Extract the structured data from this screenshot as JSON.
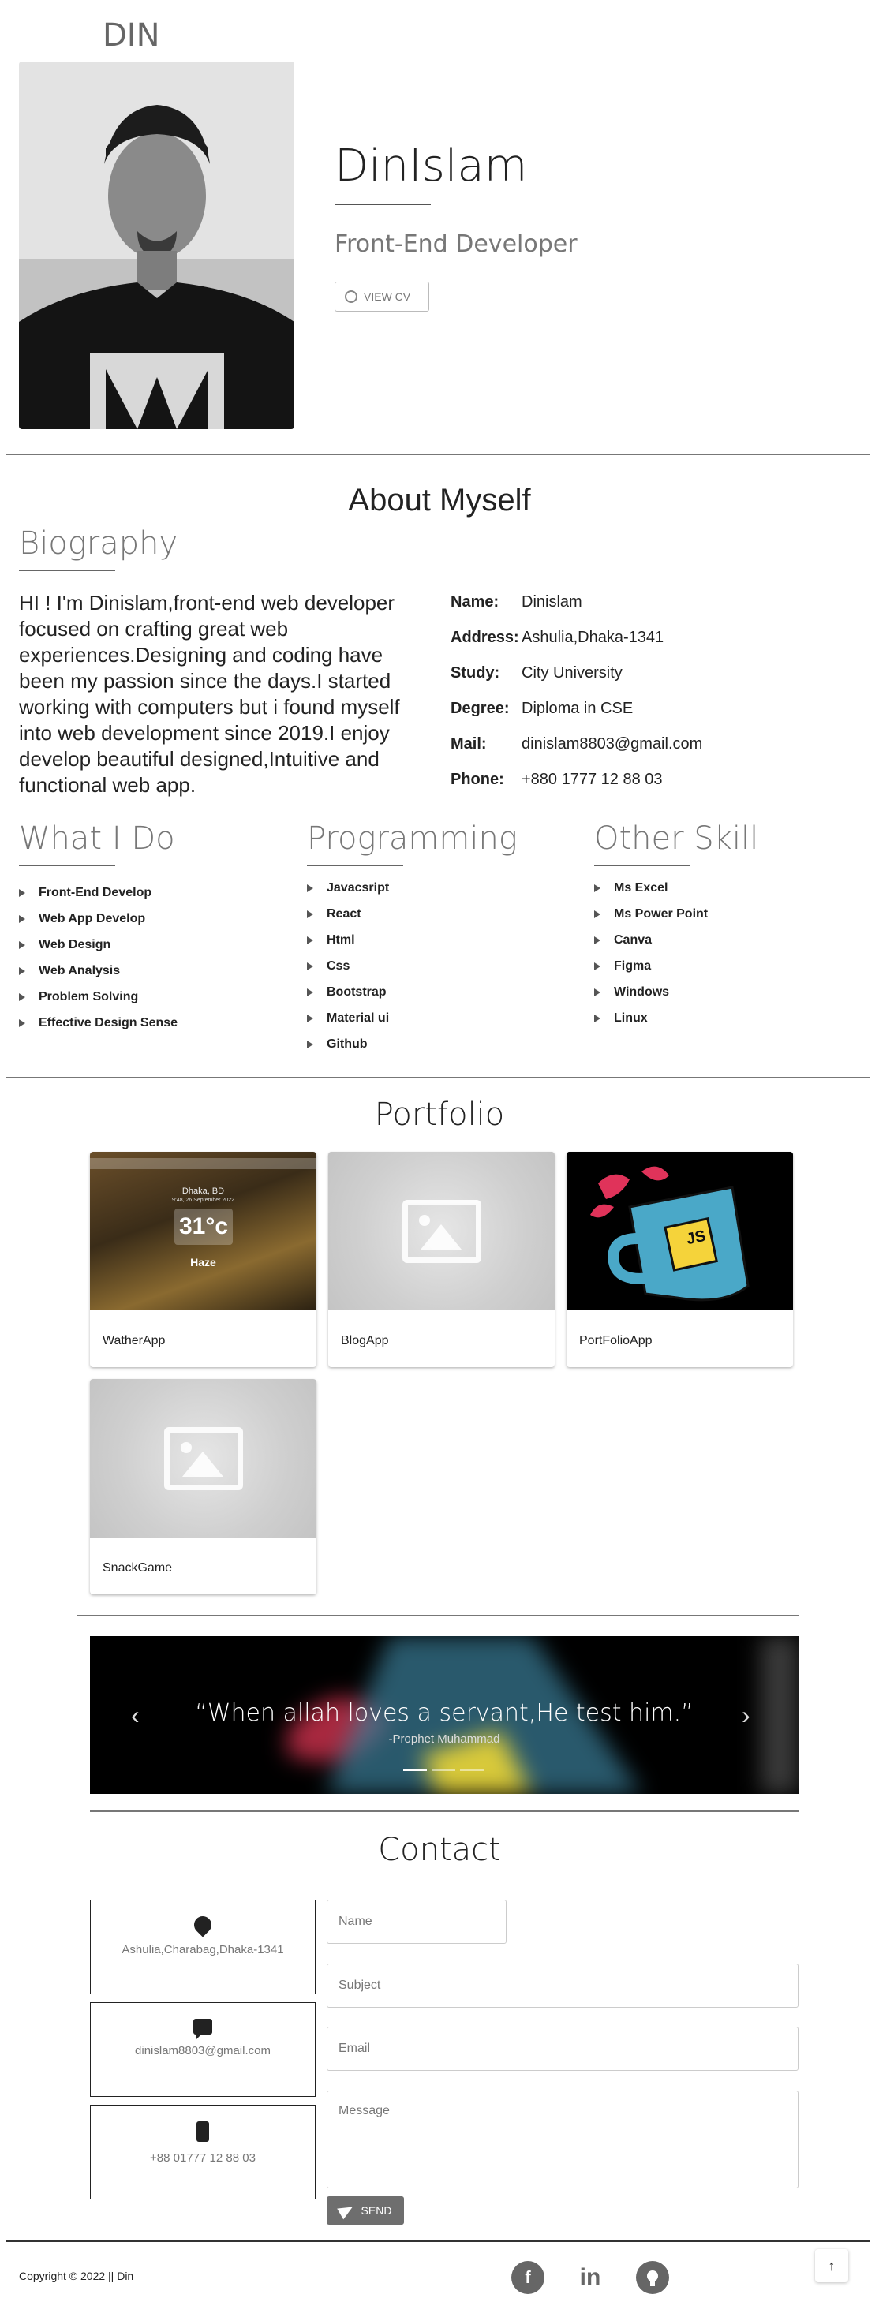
{
  "header": {
    "brand": "DIN"
  },
  "hero": {
    "name": "DinIslam",
    "role": "Front-End Developer",
    "cv_button": "VIEW CV"
  },
  "about": {
    "title": "About Myself",
    "biography_title": "Biography",
    "biography": "HI ! I'm Dinislam,front-end web developer focused on crafting great web experiences.Designing and coding have been my passion since the days.I started working with computers but i found myself into web development since 2019.I enjoy develop beautiful designed,Intuitive and functional web app.",
    "info": [
      {
        "label": "Name:",
        "value": "Dinislam"
      },
      {
        "label": "Address:",
        "value": "Ashulia,Dhaka-1341"
      },
      {
        "label": "Study:",
        "value": "City University"
      },
      {
        "label": "Degree:",
        "value": "Diploma in CSE"
      },
      {
        "label": "Mail:",
        "value": "dinislam8803@gmail.com"
      },
      {
        "label": "Phone:",
        "value": "+880 1777 12 88 03"
      }
    ]
  },
  "skills": {
    "what_i_do": {
      "title": "What I Do",
      "items": [
        "Front-End Develop",
        "Web App Develop",
        "Web Design",
        "Web Analysis",
        "Problem Solving",
        "Effective Design Sense"
      ]
    },
    "programming": {
      "title": "Programming",
      "items": [
        "Javacsript",
        "React",
        "Html",
        "Css",
        "Bootstrap",
        "Material ui",
        "Github"
      ]
    },
    "other": {
      "title": "Other Skill",
      "items": [
        "Ms Excel",
        "Ms Power Point",
        "Canva",
        "Figma",
        "Windows",
        "Linux"
      ]
    }
  },
  "portfolio": {
    "title": "Portfolio",
    "cards": [
      {
        "name": "WatherApp"
      },
      {
        "name": "BlogApp"
      },
      {
        "name": "PortFolioApp"
      },
      {
        "name": "SnackGame"
      }
    ],
    "weather_preview": {
      "city": "Dhaka, BD",
      "date": "9:48, 26 September 2022",
      "temp": "31°c",
      "condition": "Haze"
    },
    "js_badge": "JS"
  },
  "carousel": {
    "quote": "“When allah loves a servant,He test him.”",
    "attribution": "-Prophet Muhammad",
    "prev_icon": "‹",
    "next_icon": "›"
  },
  "contact": {
    "title": "Contact",
    "cards": [
      {
        "icon": "map-pin-icon",
        "text": "Ashulia,Charabag,Dhaka-1341"
      },
      {
        "icon": "chat-icon",
        "text": "dinislam8803@gmail.com"
      },
      {
        "icon": "phone-icon",
        "text": "+88 01777 12 88 03"
      }
    ],
    "form": {
      "name_placeholder": "Name",
      "subject_placeholder": "Subject",
      "email_placeholder": "Email",
      "message_placeholder": "Message",
      "send_label": "SEND"
    }
  },
  "footer": {
    "copyright": "Copyright © 2022 || Din",
    "social": [
      "facebook-icon",
      "linkedin-icon",
      "github-icon"
    ],
    "to_top_icon": "↑"
  }
}
